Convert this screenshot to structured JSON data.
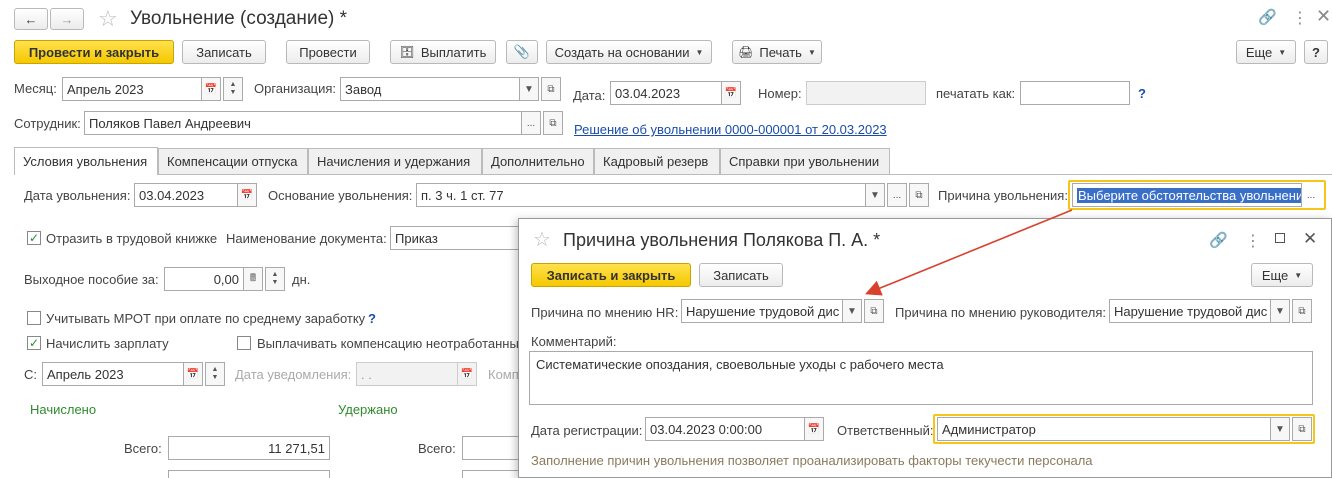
{
  "window": {
    "title": "Увольнение (создание) *"
  },
  "toolbar": {
    "post_and_close": "Провести и закрыть",
    "save": "Записать",
    "post": "Провести",
    "pay": "Выплатить",
    "create_based_on": "Создать на основании",
    "print": "Печать",
    "more": "Еще",
    "help": "?"
  },
  "header": {
    "month_label": "Месяц:",
    "month_value": "Апрель 2023",
    "org_label": "Организация:",
    "org_value": "Завод",
    "date_label": "Дата:",
    "date_value": "03.04.2023",
    "number_label": "Номер:",
    "number_value": "",
    "print_as_label": "печатать как:",
    "print_as_value": "",
    "help": "?",
    "employee_label": "Сотрудник:",
    "employee_value": "Поляков Павел Андреевич",
    "decision_link": "Решение об увольнении 0000-000001 от 20.03.2023"
  },
  "tabs": [
    {
      "label": "Условия увольнения"
    },
    {
      "label": "Компенсации отпуска"
    },
    {
      "label": "Начисления и удержания"
    },
    {
      "label": "Дополнительно"
    },
    {
      "label": "Кадровый резерв"
    },
    {
      "label": "Справки при увольнении"
    }
  ],
  "conditions": {
    "dismissal_date_label": "Дата увольнения:",
    "dismissal_date_value": "03.04.2023",
    "basis_label": "Основание увольнения:",
    "basis_value": "п. 3 ч. 1 ст. 77",
    "reason_label": "Причина увольнения:",
    "reason_value": "Выберите обстоятельства увольнения",
    "workbook_label": "Отразить в трудовой книжке",
    "doc_name_label": "Наименование документа:",
    "doc_name_value": "Приказ",
    "severance_label": "Выходное пособие за:",
    "severance_value": "0,00",
    "days_label": "дн.",
    "mrot_label": "Учитывать МРОТ при оплате по среднему заработку",
    "mrot_help": "?",
    "accrue_salary_label": "Начислить зарплату",
    "pay_unworked_label": "Выплачивать компенсацию неотработанных",
    "from_label": "С:",
    "from_value": "Апрель 2023",
    "notice_date_label": "Дата уведомления:",
    "notice_date_value": " .  .",
    "comp_label": "Комп",
    "accrued_label": "Начислено",
    "withheld_label": "Удержано",
    "total_label": "Всего:",
    "total_value": "11 271,51",
    "total2_label": "Всего:",
    "total2_value": ""
  },
  "popup": {
    "title": "Причина увольнения Полякова П. А. *",
    "save_and_close": "Записать и закрыть",
    "save": "Записать",
    "more": "Еще",
    "hr_reason_label": "Причина по мнению HR:",
    "hr_reason_value": "Нарушение трудовой дис",
    "manager_reason_label": "Причина по мнению руководителя:",
    "manager_reason_value": "Нарушение трудовой дис",
    "comment_label": "Комментарий:",
    "comment_value": "Систематические опоздания, своевольные уходы с рабочего места",
    "reg_date_label": "Дата регистрации:",
    "reg_date_value": "03.04.2023  0:00:00",
    "responsible_label": "Ответственный:",
    "responsible_value": "Администратор",
    "hint": "Заполнение причин увольнения позволяет проанализировать факторы текучести персонала"
  },
  "colors": {
    "primary_button": "#f5c800",
    "highlight_frame": "#f5c518",
    "link": "#1a4dab",
    "arrow": "#d9412c",
    "section_green": "#2e8b2e"
  }
}
